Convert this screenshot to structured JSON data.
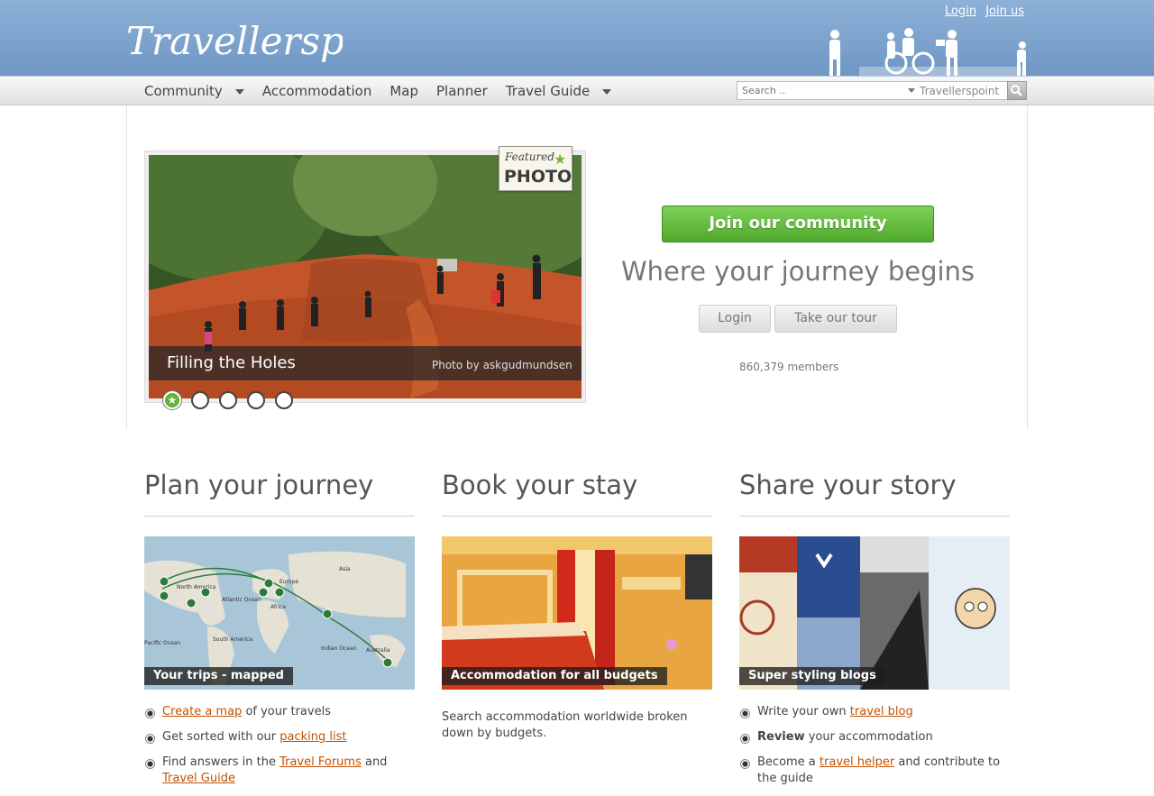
{
  "header": {
    "logo_text": "Travellerspoint",
    "login_link": "Login",
    "join_link": "Join us"
  },
  "nav": {
    "items": [
      {
        "label": "Community",
        "dropdown": true
      },
      {
        "label": "Accommodation",
        "dropdown": false
      },
      {
        "label": "Map",
        "dropdown": false
      },
      {
        "label": "Planner",
        "dropdown": false
      },
      {
        "label": "Travel Guide",
        "dropdown": true
      }
    ],
    "search_placeholder": "Search ..",
    "search_scope": "Travellerspoint"
  },
  "featured": {
    "badge_line1": "Featured",
    "badge_line2": "PHOTO",
    "title": "Filling the Holes",
    "credit": "Photo by askgudmundsen",
    "slides": 5,
    "active_slide": 1
  },
  "hero": {
    "join_button": "Join our community",
    "tagline": "Where your journey begins",
    "login_button": "Login",
    "tour_button": "Take our tour",
    "members": "860,379 members"
  },
  "columns": {
    "plan": {
      "heading": "Plan your journey",
      "thumb_label": "Your trips - mapped",
      "bullets": [
        {
          "link": "Create a map",
          "text": " of your travels"
        },
        {
          "text": "Get sorted with our ",
          "link": "packing list"
        },
        {
          "text": "Find answers in the ",
          "link": "Travel Forums",
          "text2": " and ",
          "link2": "Travel Guide"
        }
      ],
      "map_labels": [
        "North America",
        "Atlantic Ocean",
        "Africa",
        "Asia",
        "Europe",
        "South America",
        "Indian Ocean",
        "Australia",
        "Pacific Ocean"
      ]
    },
    "book": {
      "heading": "Book your stay",
      "thumb_label": "Accommodation for all budgets",
      "text": "Search accommodation worldwide broken down by budgets."
    },
    "share": {
      "heading": "Share your story",
      "thumb_label": "Super styling blogs",
      "bullets": [
        {
          "text": "Write your own ",
          "link": "travel blog"
        },
        {
          "bold": "Review",
          "text": " your accommodation"
        },
        {
          "text": "Become a ",
          "link": "travel helper",
          "text2": " and contribute to the guide"
        }
      ]
    }
  },
  "colors": {
    "header_blue": "#7aa1cd",
    "join_green": "#5cb536",
    "link_orange": "#c45200"
  }
}
